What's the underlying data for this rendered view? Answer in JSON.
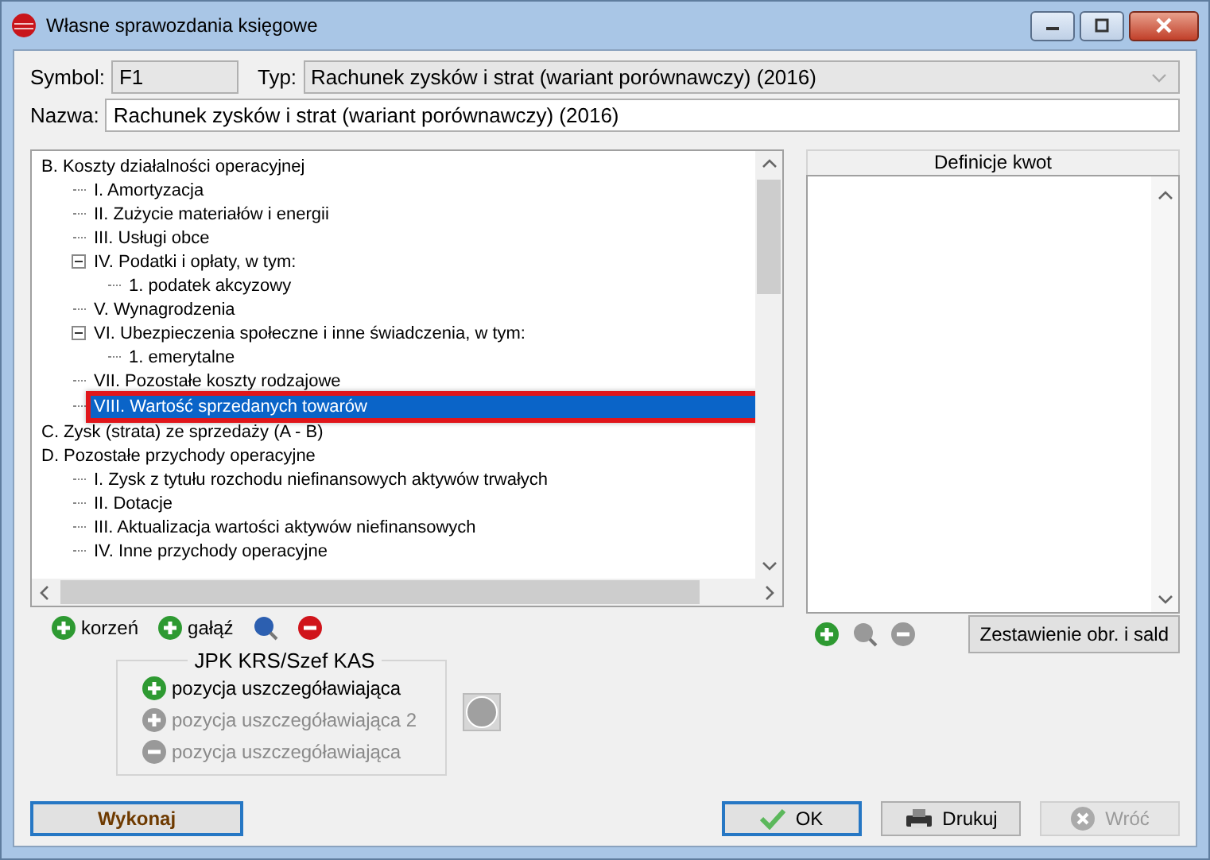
{
  "window": {
    "title": "Własne sprawozdania księgowe"
  },
  "symbol": {
    "label": "Symbol:",
    "value": "F1"
  },
  "typ": {
    "label": "Typ:",
    "value": "Rachunek zysków i strat (wariant porównawczy) (2016)",
    "disabled": true
  },
  "nazwa": {
    "label": "Nazwa:",
    "value": "Rachunek zysków i strat (wariant porównawczy) (2016)"
  },
  "tree": [
    {
      "label": "B. Koszty działalności operacyjnej",
      "selected": false,
      "children": [
        {
          "label": "I. Amortyzacja",
          "selected": false
        },
        {
          "label": "II. Zużycie materiałów i energii",
          "selected": false
        },
        {
          "label": "III. Usługi obce",
          "selected": false
        },
        {
          "label": "IV. Podatki i opłaty, w tym:",
          "selected": false,
          "expanded": true,
          "children": [
            {
              "label": "1. podatek akcyzowy",
              "selected": false
            }
          ]
        },
        {
          "label": "V. Wynagrodzenia",
          "selected": false
        },
        {
          "label": "VI. Ubezpieczenia społeczne i inne świadczenia, w tym:",
          "selected": false,
          "expanded": true,
          "children": [
            {
              "label": "1. emerytalne",
              "selected": false
            }
          ]
        },
        {
          "label": "VII. Pozostałe koszty rodzajowe",
          "selected": false
        },
        {
          "label": "VIII. Wartość sprzedanych towarów",
          "selected": true
        }
      ]
    },
    {
      "label": "C. Zysk (strata) ze sprzedaży (A - B)",
      "selected": false
    },
    {
      "label": "D. Pozostałe przychody operacyjne",
      "selected": false,
      "children": [
        {
          "label": "I. Zysk z tytułu rozchodu niefinansowych aktywów trwałych",
          "selected": false
        },
        {
          "label": "II. Dotacje",
          "selected": false
        },
        {
          "label": "III. Aktualizacja wartości aktywów niefinansowych",
          "selected": false
        },
        {
          "label": "IV. Inne przychody operacyjne",
          "selected": false
        }
      ]
    }
  ],
  "tree_toolbar": [
    {
      "kind": "add",
      "label": "korzeń",
      "disabled": false
    },
    {
      "kind": "add",
      "label": "gałąź",
      "disabled": false
    },
    {
      "kind": "find",
      "disabled": false
    },
    {
      "kind": "remove",
      "disabled": false
    }
  ],
  "definitions": {
    "title": "Definicje kwot",
    "toolbar": [
      {
        "kind": "add",
        "disabled": false
      },
      {
        "kind": "find",
        "disabled": true
      },
      {
        "kind": "remove",
        "disabled": true
      }
    ],
    "button": "Zestawienie obr. i sald"
  },
  "jpk": {
    "title": "JPK KRS/Szef KAS",
    "items": [
      {
        "kind": "add",
        "label": "pozycja uszczegóławiająca",
        "disabled": false
      },
      {
        "kind": "add",
        "label": "pozycja uszczegóławiająca 2",
        "disabled": true
      },
      {
        "kind": "remove",
        "label": "pozycja uszczegóławiająca",
        "disabled": true
      }
    ]
  },
  "buttons": [
    {
      "kind": "run",
      "label": "Wykonaj",
      "disabled": false
    },
    {
      "kind": "ok",
      "label": "OK",
      "disabled": false
    },
    {
      "kind": "print",
      "label": "Drukuj",
      "disabled": false
    },
    {
      "kind": "back",
      "label": "Wróć",
      "disabled": true
    }
  ]
}
